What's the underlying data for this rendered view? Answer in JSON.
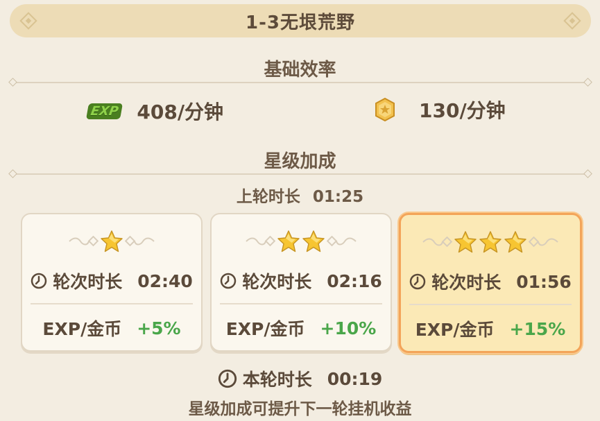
{
  "stage": {
    "title": "1-3无垠荒野"
  },
  "base_efficiency": {
    "title": "基础效率",
    "exp_icon_text": "EXP",
    "exp_rate": "408/分钟",
    "coin_rate": "130/分钟"
  },
  "star_bonus": {
    "title": "星级加成",
    "last_round_label": "上轮时长",
    "last_round_value": "01:25"
  },
  "cards": [
    {
      "stars": 1,
      "duration_label": "轮次时长",
      "duration": "02:40",
      "reward_label": "EXP/金币",
      "bonus": "+5%",
      "selected": false
    },
    {
      "stars": 2,
      "duration_label": "轮次时长",
      "duration": "02:16",
      "reward_label": "EXP/金币",
      "bonus": "+10%",
      "selected": false
    },
    {
      "stars": 3,
      "duration_label": "轮次时长",
      "duration": "01:56",
      "reward_label": "EXP/金币",
      "bonus": "+15%",
      "selected": true
    }
  ],
  "current_round": {
    "label": "本轮时长",
    "value": "00:19"
  },
  "hint": "星级加成可提升下一轮挂机收益",
  "colors": {
    "accent": "#f3a459",
    "bonus_green": "#4aa64a",
    "star_gold": "#f7c531"
  }
}
